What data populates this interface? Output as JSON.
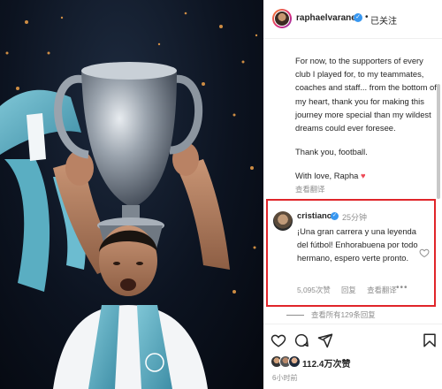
{
  "post": {
    "author": {
      "username": "raphaelvarane",
      "follow_status": "已关注"
    },
    "caption": {
      "paragraph_1": "For now, to the supporters of every club I played for, to my teammates, coaches and staff... from the bottom of my heart, thank you for making this journey more special than my wildest dreams could ever foresee.",
      "paragraph_2": "Thank you, football.",
      "signoff": "With love, Rapha",
      "heart": "♥",
      "translate_label": "查看翻译"
    },
    "highlighted_comment": {
      "username": "cristiano",
      "time": "25分钟",
      "text": "¡Una gran carrera y una leyenda del fútbol! Enhorabuena por todo hermano, espero verte pronto.",
      "likes": "5,095次赞",
      "reply_label": "回复",
      "translate_label": "查看翻译",
      "more": "•••"
    },
    "view_all_replies": "查看所有129条回复",
    "likes_count": "112.4万次赞",
    "posted_time": "6小时前"
  },
  "colors": {
    "verified": "#3897f0",
    "highlight_border": "#e0252a",
    "heart": "#ed4956",
    "muted_text": "#8e8e8e"
  },
  "icons": [
    "heart-icon",
    "comment-icon",
    "share-icon",
    "save-icon",
    "verified-icon"
  ]
}
